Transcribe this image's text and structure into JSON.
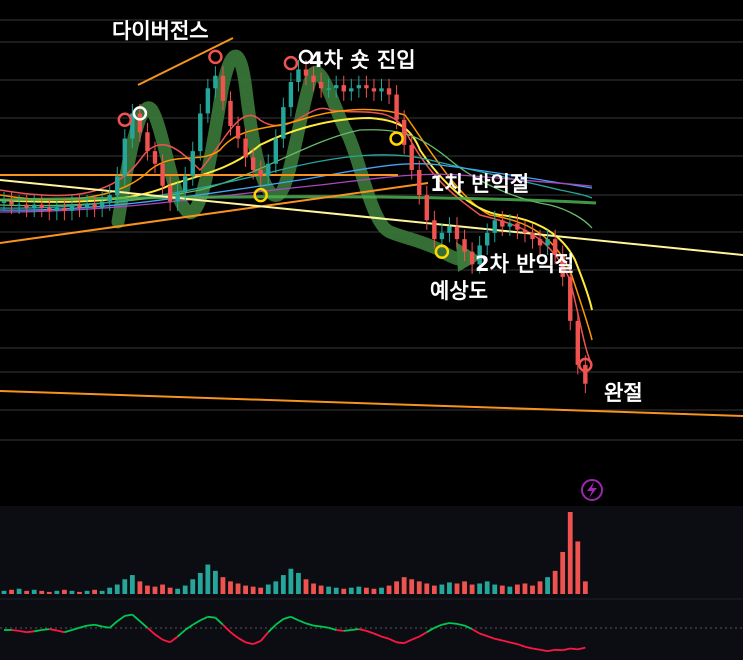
{
  "annotations": {
    "divergence": "다이버전스",
    "entry4": "4차 숏 진입",
    "tp1": "1차 반익절",
    "tp2": "2차 반익절",
    "forecast": "예상도",
    "full_exit": "완절"
  },
  "colors": {
    "background": "#000000",
    "bull": "#26a69a",
    "bear": "#ef5350",
    "gridline": "#8a8a8a",
    "trendline": "#f7931e",
    "forecast_path": "#3a7a3a",
    "marker_red": "#ef5350",
    "marker_white": "#ffffff",
    "marker_yellow": "#ffd600",
    "oscillator_up": "#00c853",
    "oscillator_down": "#ff1744",
    "alert_icon": "#9c27b0"
  },
  "icons": {
    "alert": "lightning-icon"
  },
  "chart_data": {
    "type": "candlestick",
    "panels": [
      "price",
      "volume",
      "oscillator"
    ],
    "title": "",
    "xlabel": "",
    "ylabel": "",
    "grid": true,
    "legend": "none",
    "price_close": [
      0.5,
      0.49,
      0.49,
      0.48,
      0.49,
      0.48,
      0.47,
      0.48,
      0.47,
      0.49,
      0.48,
      0.49,
      0.48,
      0.5,
      0.52,
      0.58,
      0.7,
      0.78,
      0.72,
      0.66,
      0.62,
      0.55,
      0.5,
      0.53,
      0.58,
      0.66,
      0.78,
      0.86,
      0.9,
      0.82,
      0.74,
      0.7,
      0.64,
      0.6,
      0.58,
      0.62,
      0.7,
      0.8,
      0.88,
      0.92,
      0.9,
      0.88,
      0.86,
      0.86,
      0.87,
      0.85,
      0.86,
      0.87,
      0.86,
      0.85,
      0.86,
      0.84,
      0.76,
      0.68,
      0.6,
      0.52,
      0.44,
      0.38,
      0.4,
      0.42,
      0.38,
      0.34,
      0.3,
      0.36,
      0.4,
      0.44,
      0.42,
      0.43,
      0.41,
      0.4,
      0.38,
      0.36,
      0.38,
      0.33,
      0.26,
      0.12,
      -0.02,
      -0.08
    ],
    "volume": [
      3,
      4,
      5,
      3,
      4,
      3,
      2,
      3,
      4,
      3,
      2,
      3,
      4,
      3,
      6,
      9,
      14,
      18,
      12,
      8,
      7,
      9,
      6,
      5,
      8,
      14,
      20,
      28,
      22,
      16,
      12,
      10,
      8,
      7,
      6,
      9,
      12,
      18,
      24,
      20,
      14,
      10,
      8,
      7,
      6,
      5,
      6,
      7,
      6,
      5,
      6,
      8,
      12,
      16,
      14,
      12,
      10,
      8,
      9,
      11,
      10,
      12,
      9,
      10,
      12,
      9,
      8,
      7,
      9,
      10,
      8,
      12,
      16,
      22,
      40,
      78,
      50,
      12
    ],
    "oscillator": [
      0.5,
      0.5,
      0.48,
      0.45,
      0.47,
      0.5,
      0.52,
      0.49,
      0.45,
      0.5,
      0.55,
      0.6,
      0.62,
      0.58,
      0.55,
      0.7,
      0.82,
      0.85,
      0.7,
      0.55,
      0.4,
      0.28,
      0.22,
      0.35,
      0.5,
      0.62,
      0.72,
      0.8,
      0.78,
      0.62,
      0.45,
      0.32,
      0.22,
      0.18,
      0.25,
      0.45,
      0.62,
      0.75,
      0.8,
      0.72,
      0.65,
      0.6,
      0.58,
      0.55,
      0.5,
      0.48,
      0.5,
      0.52,
      0.48,
      0.42,
      0.35,
      0.3,
      0.22,
      0.2,
      0.28,
      0.35,
      0.45,
      0.55,
      0.62,
      0.66,
      0.64,
      0.6,
      0.52,
      0.42,
      0.36,
      0.3,
      0.26,
      0.22,
      0.18,
      0.12,
      0.08,
      0.05,
      0.02,
      0.05,
      0.04,
      0.08,
      0.06,
      0.1
    ],
    "signals": [
      {
        "bar": 16,
        "kind": "sell",
        "color": "red"
      },
      {
        "bar": 18,
        "kind": "sell",
        "color": "white"
      },
      {
        "bar": 28,
        "kind": "sell",
        "color": "red"
      },
      {
        "bar": 34,
        "kind": "buy",
        "color": "yellow"
      },
      {
        "bar": 38,
        "kind": "sell",
        "color": "red"
      },
      {
        "bar": 40,
        "kind": "sell",
        "color": "white"
      },
      {
        "bar": 52,
        "kind": "buy",
        "color": "yellow"
      },
      {
        "bar": 58,
        "kind": "buy",
        "color": "yellow"
      },
      {
        "bar": 77,
        "kind": "sell",
        "color": "red"
      }
    ]
  }
}
